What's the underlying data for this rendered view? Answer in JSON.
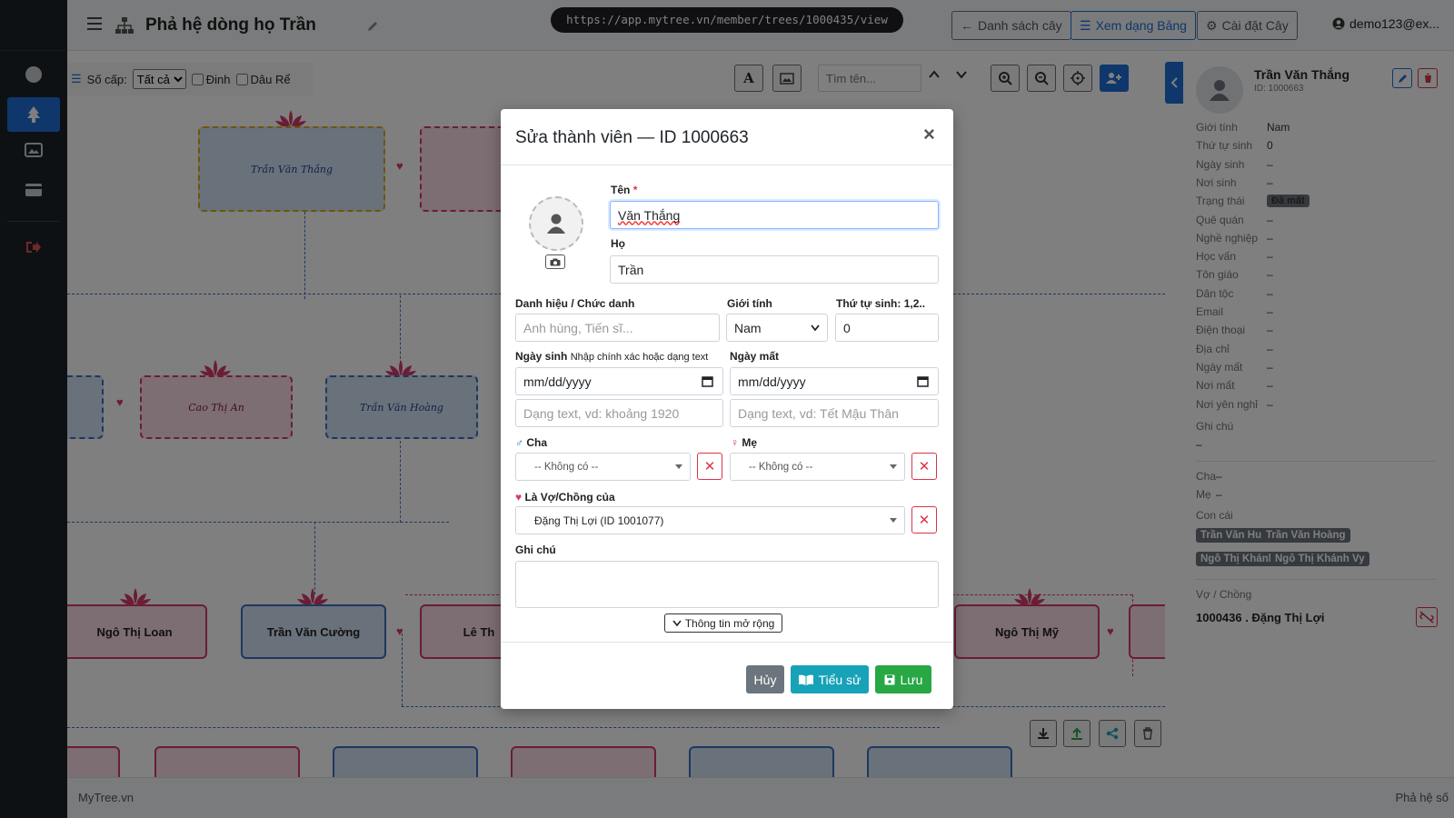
{
  "browser": {
    "url": "https://app.mytree.vn/member/trees/1000435/view"
  },
  "header": {
    "title": "Phả hệ dòng họ Trần",
    "btn_list": "Danh sách cây",
    "btn_table": "Xem dạng Bảng",
    "btn_settings": "Cài đặt Cây",
    "user": "demo123@ex..."
  },
  "canvas_toolbar": {
    "level_label": "Số cấp:",
    "level_value": "Tất cả",
    "dinh_label": "Đinh",
    "dau_re_label": "Dâu Rể",
    "search_placeholder": "Tìm tên..."
  },
  "tree": {
    "nodes": {
      "n1": "Trần Văn Thắng",
      "n2": "Cao Thị An",
      "n3": "Trần Văn Hoàng",
      "n4": "Ngô Thị Loan",
      "n5": "Trần Văn Cường",
      "n6": "Lê Th",
      "n7": "Ngô Thị Mỹ"
    }
  },
  "modal": {
    "title": "Sửa thành viên — ID 1000663",
    "close": "×",
    "first_name_label": "Tên",
    "required_mark": "*",
    "first_name_value": "Văn Thắng",
    "last_name_label": "Họ",
    "last_name_value": "Trần",
    "honorific_label": "Danh hiệu / Chức danh",
    "honorific_placeholder": "Anh hùng, Tiến sĩ...",
    "gender_label": "Giới tính",
    "gender_value": "Nam",
    "birth_order_label": "Thứ tự sinh: 1,2..",
    "birth_order_value": "0",
    "dob_label": "Ngày sinh",
    "dob_hint": "Nhập chính xác hoặc dạng text",
    "dob_date_placeholder": "mm/dd/yyyy",
    "dob_text_placeholder": "Dạng text, vd: khoảng 1920",
    "dod_label": "Ngày mất",
    "dod_date_placeholder": "mm/dd/yyyy",
    "dod_text_placeholder": "Dạng text, vd: Tết Mậu Thân",
    "father_label": "Cha",
    "father_value": "-- Không có --",
    "mother_label": "Mẹ",
    "mother_value": "-- Không có --",
    "spouse_label": "Là Vợ/Chồng của",
    "spouse_value": "Đặng Thị Lợi (ID 1001077)",
    "note_label": "Ghi chú",
    "expand_label": "Thông tin mở rộng",
    "btn_cancel": "Hủy",
    "btn_bio": "Tiểu sử",
    "btn_save": "Lưu"
  },
  "panel": {
    "name": "Trần Văn Thắng",
    "id": "ID: 1000663",
    "fields": [
      {
        "k": "Giới tính",
        "v": "Nam"
      },
      {
        "k": "Thứ tự sinh",
        "v": "0"
      },
      {
        "k": "Ngày sinh",
        "v": "–"
      },
      {
        "k": "Nơi sinh",
        "v": "–"
      },
      {
        "k": "Trạng thái",
        "v": "Đã mất"
      },
      {
        "k": "Quê quán",
        "v": "–"
      },
      {
        "k": "Nghề nghiệp",
        "v": "–"
      },
      {
        "k": "Học vấn",
        "v": "–"
      },
      {
        "k": "Tôn giáo",
        "v": "–"
      },
      {
        "k": "Dân tộc",
        "v": "–"
      },
      {
        "k": "Email",
        "v": "–"
      },
      {
        "k": "Điện thoại",
        "v": "–"
      },
      {
        "k": "Địa chỉ",
        "v": "–"
      },
      {
        "k": "Ngày mất",
        "v": "–"
      },
      {
        "k": "Nơi mất",
        "v": "–"
      },
      {
        "k": "Nơi yên nghỉ",
        "v": "–"
      }
    ],
    "note_label": "Ghi chú",
    "note_value": "–",
    "father_label": "Cha",
    "father_value": "–",
    "mother_label": "Mẹ",
    "mother_value": "–",
    "children_label": "Con cái",
    "children": [
      "Trần Văn Huy",
      "Trần Văn Hoàng",
      "Ngô Thị Khánh",
      "Ngô Thị Khánh Vy"
    ],
    "spouse_label": "Vợ / Chồng",
    "spouse_value": "1000436 . Đặng Thị Lợi"
  },
  "footer": {
    "left": "MyTree.vn",
    "right": "Phả hệ số"
  }
}
